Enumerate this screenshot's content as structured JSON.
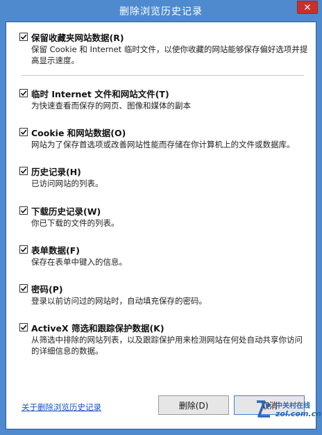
{
  "window": {
    "title": "删除浏览历史记录",
    "close_glyph": "✕"
  },
  "items": [
    {
      "label": "保留收藏夹网站数据(R)",
      "description": "保留 Cookie 和 Internet 临时文件，以使你收藏的网站能够保存偏好选项并提高显示速度。",
      "checked": true
    },
    {
      "label": "临时 Internet 文件和网站文件(T)",
      "description": "为快速查看而保存的网页、图像和媒体的副本",
      "checked": true
    },
    {
      "label": "Cookie 和网站数据(O)",
      "description": "网站为了保存首选项或改善网站性能而存储在你计算机上的文件或数据库。",
      "checked": true
    },
    {
      "label": "历史记录(H)",
      "description": "已访问网站的列表。",
      "checked": true
    },
    {
      "label": "下载历史记录(W)",
      "description": "你已下载的文件的列表。",
      "checked": true
    },
    {
      "label": "表单数据(F)",
      "description": "保存在表单中键入的信息。",
      "checked": true
    },
    {
      "label": "密码(P)",
      "description": "登录以前访问过的网站时，自动填充保存的密码。",
      "checked": true
    },
    {
      "label": "ActiveX 筛选和跟踪保护数据(K)",
      "description": "从筛选中排除的网站列表，以及跟踪保护用来检测网站在何处自动共享你访问的详细信息的数据。",
      "checked": true
    }
  ],
  "footer": {
    "about_link": "关于删除浏览历史记录",
    "delete_button": "删除(D)",
    "cancel_button": "取消"
  },
  "watermark": {
    "top": "中关村在线",
    "bottom": "zol.com.cn"
  },
  "colors": {
    "frame": "#4f8ace",
    "close": "#c7312c",
    "link": "#1a52c2",
    "watermark": "#2a66b6"
  }
}
